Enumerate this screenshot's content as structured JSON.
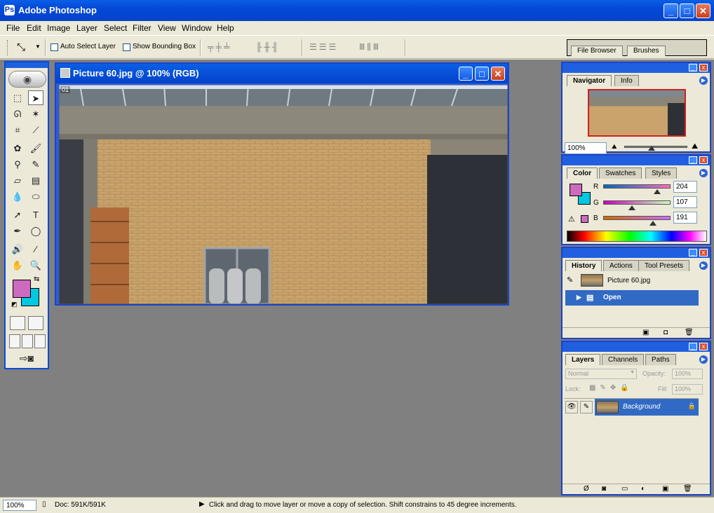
{
  "app": {
    "title": "Adobe Photoshop"
  },
  "menu": [
    "File",
    "Edit",
    "Image",
    "Layer",
    "Select",
    "Filter",
    "View",
    "Window",
    "Help"
  ],
  "options": {
    "auto_select_layer": "Auto Select Layer",
    "show_bounding_box": "Show Bounding Box",
    "well_tabs": [
      "File Browser",
      "Brushes"
    ]
  },
  "document": {
    "title": "Picture 60.jpg @ 100% (RGB)",
    "corner_label": "01"
  },
  "navigator": {
    "tabs": [
      "Navigator",
      "Info"
    ],
    "zoom": "100%"
  },
  "color": {
    "tabs": [
      "Color",
      "Swatches",
      "Styles"
    ],
    "r_label": "R",
    "g_label": "G",
    "b_label": "B",
    "r_value": "204",
    "g_value": "107",
    "b_value": "191",
    "foreground": "#cc6bbf",
    "background": "#00c8e0"
  },
  "history": {
    "tabs": [
      "History",
      "Actions",
      "Tool Presets"
    ],
    "snapshot": "Picture 60.jpg",
    "steps": [
      "Open"
    ]
  },
  "layers": {
    "tabs": [
      "Layers",
      "Channels",
      "Paths"
    ],
    "blend_mode": "Normal",
    "opacity_label": "Opacity:",
    "opacity_value": "100%",
    "lock_label": "Lock:",
    "fill_label": "Fill:",
    "fill_value": "100%",
    "layer_name": "Background"
  },
  "status": {
    "zoom": "100%",
    "doc": "Doc: 591K/591K",
    "message": "Click and drag to move layer or move a copy of selection. Shift constrains to 45 degree increments."
  }
}
